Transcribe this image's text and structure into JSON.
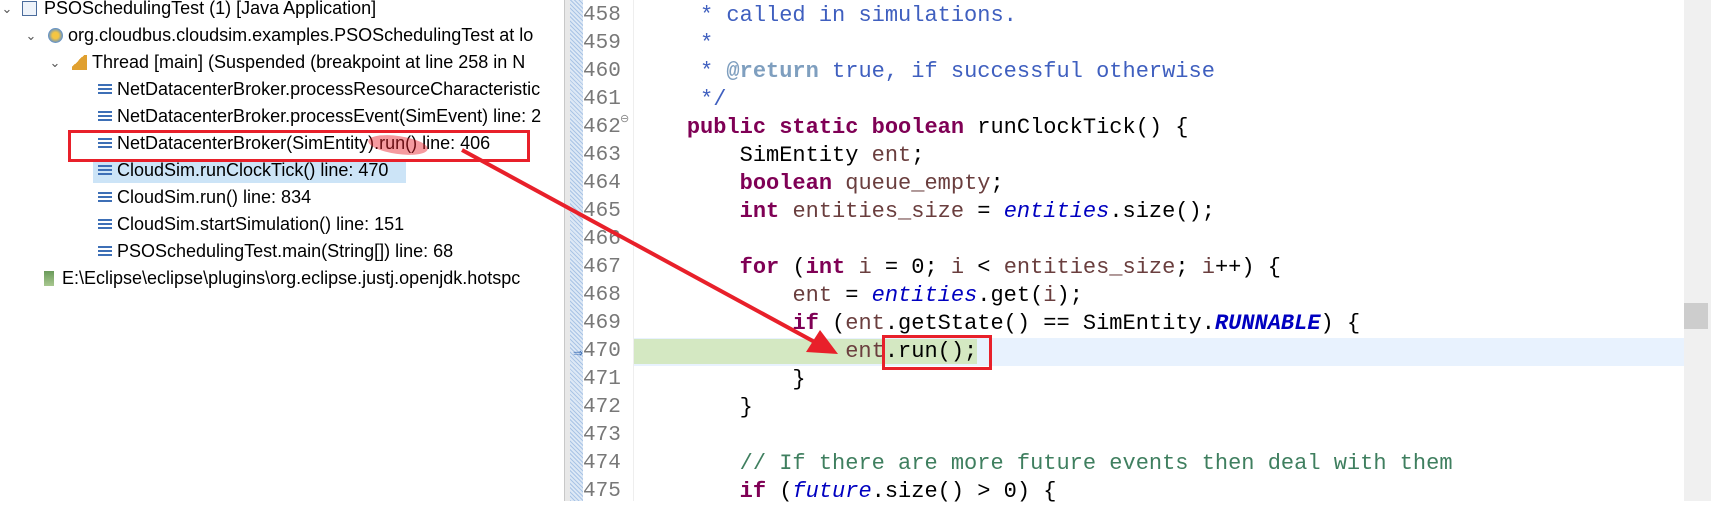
{
  "debug_tree": {
    "launch": {
      "label": "PSOSchedulingTest (1) [Java Application]",
      "icon": "java-app-icon"
    },
    "target": {
      "label": "org.cloudbus.cloudsim.examples.PSOSchedulingTest at lo",
      "icon": "debug-target-icon"
    },
    "thread": {
      "label": "Thread [main] (Suspended (breakpoint at line 258 in N",
      "icon": "thread-icon"
    },
    "frames": [
      {
        "label": "NetDatacenterBroker.processResourceCharacteristic"
      },
      {
        "label": "NetDatacenterBroker.processEvent(SimEvent) line: 2"
      },
      {
        "label": "NetDatacenterBroker(SimEntity).run() line: 406",
        "annotated": true
      },
      {
        "label": "CloudSim.runClockTick() line: 470",
        "selected": true
      },
      {
        "label": "CloudSim.run() line: 834"
      },
      {
        "label": "CloudSim.startSimulation() line: 151"
      },
      {
        "label": "PSOSchedulingTest.main(String[]) line: 68"
      }
    ],
    "process": {
      "label": "E:\\Eclipse\\eclipse\\plugins\\org.eclipse.justj.openjdk.hotspc",
      "icon": "process-icon"
    }
  },
  "editor": {
    "current_line": 470,
    "lines": [
      {
        "n": "458",
        "t": [
          [
            "     ",
            "pl"
          ],
          [
            "* called in simulations.",
            "jd"
          ]
        ]
      },
      {
        "n": "459",
        "t": [
          [
            "     ",
            "pl"
          ],
          [
            "*",
            "jd"
          ]
        ]
      },
      {
        "n": "460",
        "t": [
          [
            "     ",
            "pl"
          ],
          [
            "* ",
            "jd"
          ],
          [
            "@return",
            "tag"
          ],
          [
            " true, if successful otherwise",
            "jd"
          ]
        ]
      },
      {
        "n": "461",
        "t": [
          [
            "     ",
            "pl"
          ],
          [
            "*/",
            "jd"
          ]
        ]
      },
      {
        "n": "462",
        "t": [
          [
            "    ",
            "pl"
          ],
          [
            "public static boolean",
            "kw"
          ],
          [
            " runClockTick() {",
            "pl"
          ]
        ]
      },
      {
        "n": "463",
        "t": [
          [
            "        SimEntity ",
            "pl"
          ],
          [
            "ent",
            "lv"
          ],
          [
            ";",
            "pl"
          ]
        ]
      },
      {
        "n": "464",
        "t": [
          [
            "        ",
            "pl"
          ],
          [
            "boolean",
            "kw"
          ],
          [
            " ",
            "pl"
          ],
          [
            "queue_empty",
            "lv"
          ],
          [
            ";",
            "pl"
          ]
        ]
      },
      {
        "n": "465",
        "t": [
          [
            "        ",
            "pl"
          ],
          [
            "int",
            "kw"
          ],
          [
            " ",
            "pl"
          ],
          [
            "entities_size",
            "lv"
          ],
          [
            " = ",
            "pl"
          ],
          [
            "entities",
            "fld"
          ],
          [
            ".size();",
            "pl"
          ]
        ]
      },
      {
        "n": "466",
        "t": []
      },
      {
        "n": "467",
        "t": [
          [
            "        ",
            "pl"
          ],
          [
            "for",
            "kw"
          ],
          [
            " (",
            "pl"
          ],
          [
            "int",
            "kw"
          ],
          [
            " ",
            "pl"
          ],
          [
            "i",
            "lv"
          ],
          [
            " = 0; ",
            "pl"
          ],
          [
            "i",
            "lv"
          ],
          [
            " < ",
            "pl"
          ],
          [
            "entities_size",
            "lv"
          ],
          [
            "; ",
            "pl"
          ],
          [
            "i",
            "lv"
          ],
          [
            "++) {",
            "pl"
          ]
        ]
      },
      {
        "n": "468",
        "t": [
          [
            "            ",
            "pl"
          ],
          [
            "ent",
            "lv"
          ],
          [
            " = ",
            "pl"
          ],
          [
            "entities",
            "fld"
          ],
          [
            ".get(",
            "pl"
          ],
          [
            "i",
            "lv"
          ],
          [
            ");",
            "pl"
          ]
        ]
      },
      {
        "n": "469",
        "t": [
          [
            "            ",
            "pl"
          ],
          [
            "if",
            "kw"
          ],
          [
            " (",
            "pl"
          ],
          [
            "ent",
            "lv"
          ],
          [
            ".getState() == SimEntity.",
            "pl"
          ],
          [
            "RUNNABLE",
            "sf"
          ],
          [
            ") {",
            "pl"
          ]
        ]
      },
      {
        "n": "470",
        "t": [
          [
            "                ",
            "pl"
          ],
          [
            "ent",
            "lv"
          ],
          [
            ".run();",
            "pl"
          ]
        ]
      },
      {
        "n": "471",
        "t": [
          [
            "            }",
            "pl"
          ]
        ]
      },
      {
        "n": "472",
        "t": [
          [
            "        }",
            "pl"
          ]
        ]
      },
      {
        "n": "473",
        "t": []
      },
      {
        "n": "474",
        "t": [
          [
            "        ",
            "pl"
          ],
          [
            "// If there are more future events then deal with them",
            "cm"
          ]
        ]
      },
      {
        "n": "475",
        "t": [
          [
            "        ",
            "pl"
          ],
          [
            "if",
            "kw"
          ],
          [
            " (",
            "pl"
          ],
          [
            "future",
            "fld"
          ],
          [
            ".size() > 0) {",
            "pl"
          ]
        ]
      }
    ]
  },
  "colors": {
    "annotation_red": "#e8202a",
    "selection": "#cce4f7",
    "current_line": "#e8f2fe",
    "instruction_pointer": "#d4e8c2"
  }
}
